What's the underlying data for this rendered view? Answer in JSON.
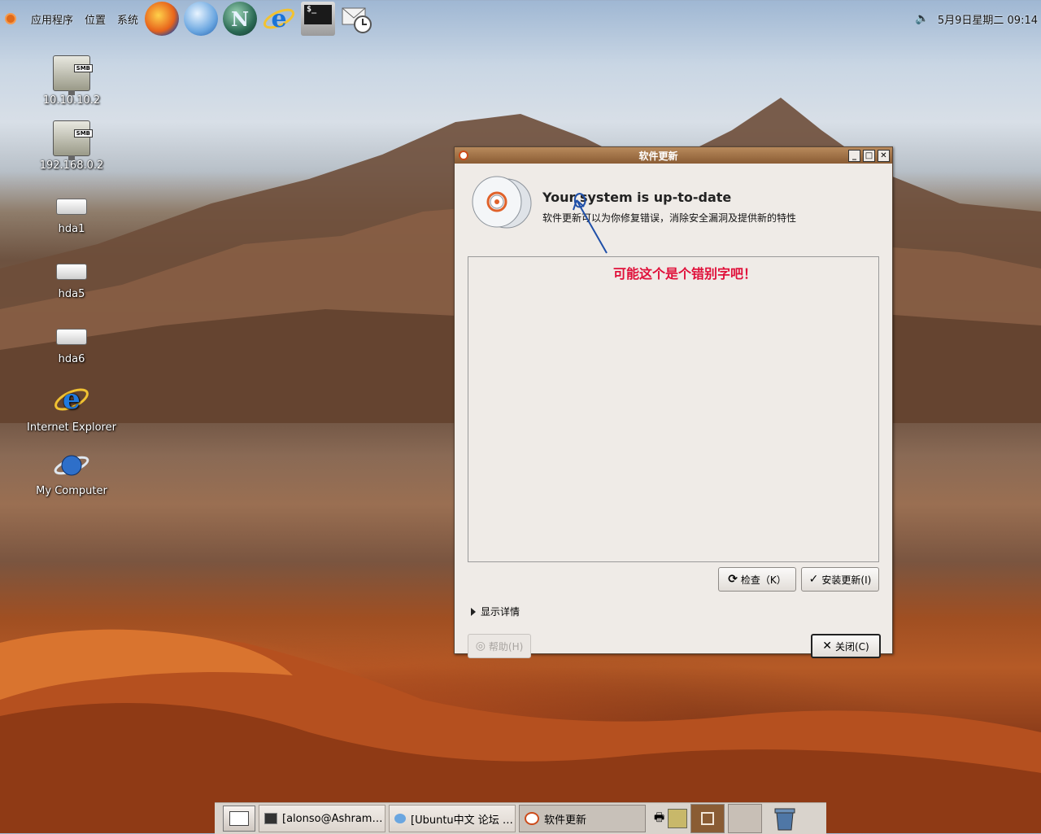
{
  "top_panel": {
    "menus": [
      "应用程序",
      "位置",
      "系统"
    ],
    "launchers": [
      {
        "name": "firefox-icon"
      },
      {
        "name": "browser-icon"
      },
      {
        "name": "netscape-icon",
        "letter": "N"
      },
      {
        "name": "ie-icon",
        "letter": "e"
      },
      {
        "name": "terminal-icon",
        "prompt": "$_"
      },
      {
        "name": "mail-clock-icon"
      }
    ],
    "clock": "5月9日星期二 09:14"
  },
  "desktop_icons": [
    {
      "label": "10.10.10.2",
      "type": "smb",
      "tag": "SMB"
    },
    {
      "label": "192.168.0.2",
      "type": "smb",
      "tag": "SMB"
    },
    {
      "label": "hda1",
      "type": "drive"
    },
    {
      "label": "hda5",
      "type": "drive"
    },
    {
      "label": "hda6",
      "type": "drive"
    },
    {
      "label": "Internet Explorer",
      "type": "ie"
    },
    {
      "label": "My Computer",
      "type": "computer"
    }
  ],
  "window": {
    "title": "软件更新",
    "headline": "Your system is up-to-date",
    "subline": "软件更新可以为你修复错误，消除安全漏洞及提供新的特性",
    "check_button": "检查（K）",
    "install_button": "安装更新(I)",
    "details": "显示详情",
    "help_button": "帮助(H)",
    "close_button": "关闭(C)"
  },
  "annotation": "可能这个是个错别字吧！",
  "taskbar": {
    "tasks": [
      {
        "label": "[alonso@Ashram…",
        "icon": "terminal-icon"
      },
      {
        "label": "[Ubuntu中文 论坛 …",
        "icon": "browser-icon"
      },
      {
        "label": "软件更新",
        "icon": "update-icon",
        "active": true
      }
    ]
  },
  "colors": {
    "titlebar": "#9a6b42",
    "annotation": "#e0103a",
    "annotation_stroke": "#1f4fa8"
  }
}
